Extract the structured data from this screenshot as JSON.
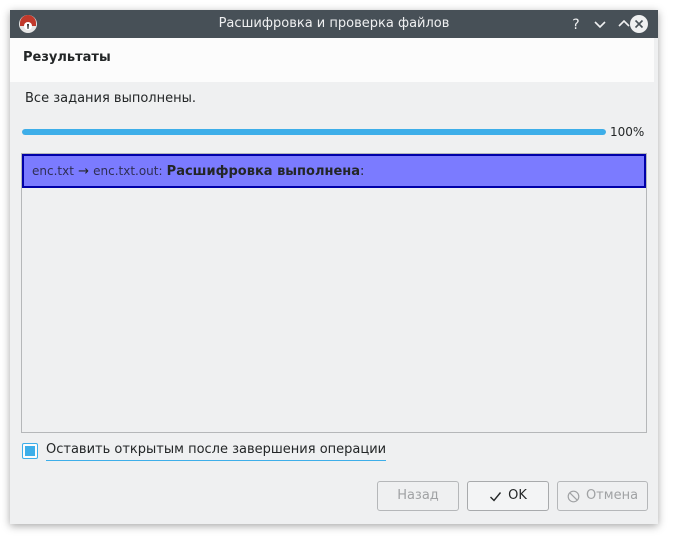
{
  "window": {
    "title": "Расшифровка и проверка файлов",
    "colors": {
      "titlebar": "#475057",
      "accent": "#3daee9",
      "selection": "#7b7bff"
    },
    "controls": {
      "help_icon": "help-icon",
      "minimize_icon": "minimize-icon",
      "maximize_icon": "maximize-icon",
      "close_icon": "close-icon"
    }
  },
  "header": {
    "title": "Результаты"
  },
  "status": {
    "message": "Все задания выполнены."
  },
  "progress": {
    "value_percent": 100,
    "label": "100%"
  },
  "results": [
    {
      "source": "enc.txt",
      "arrow": "→",
      "target": "enc.txt.out:",
      "status": "Расшифровка выполнена",
      "suffix": ":"
    }
  ],
  "options": {
    "keep_open_label": "Оставить открытым после завершения операции",
    "keep_open_checked": true
  },
  "buttons": {
    "back_label": "Назад",
    "ok_label": "OK",
    "cancel_label": "Отмена"
  }
}
